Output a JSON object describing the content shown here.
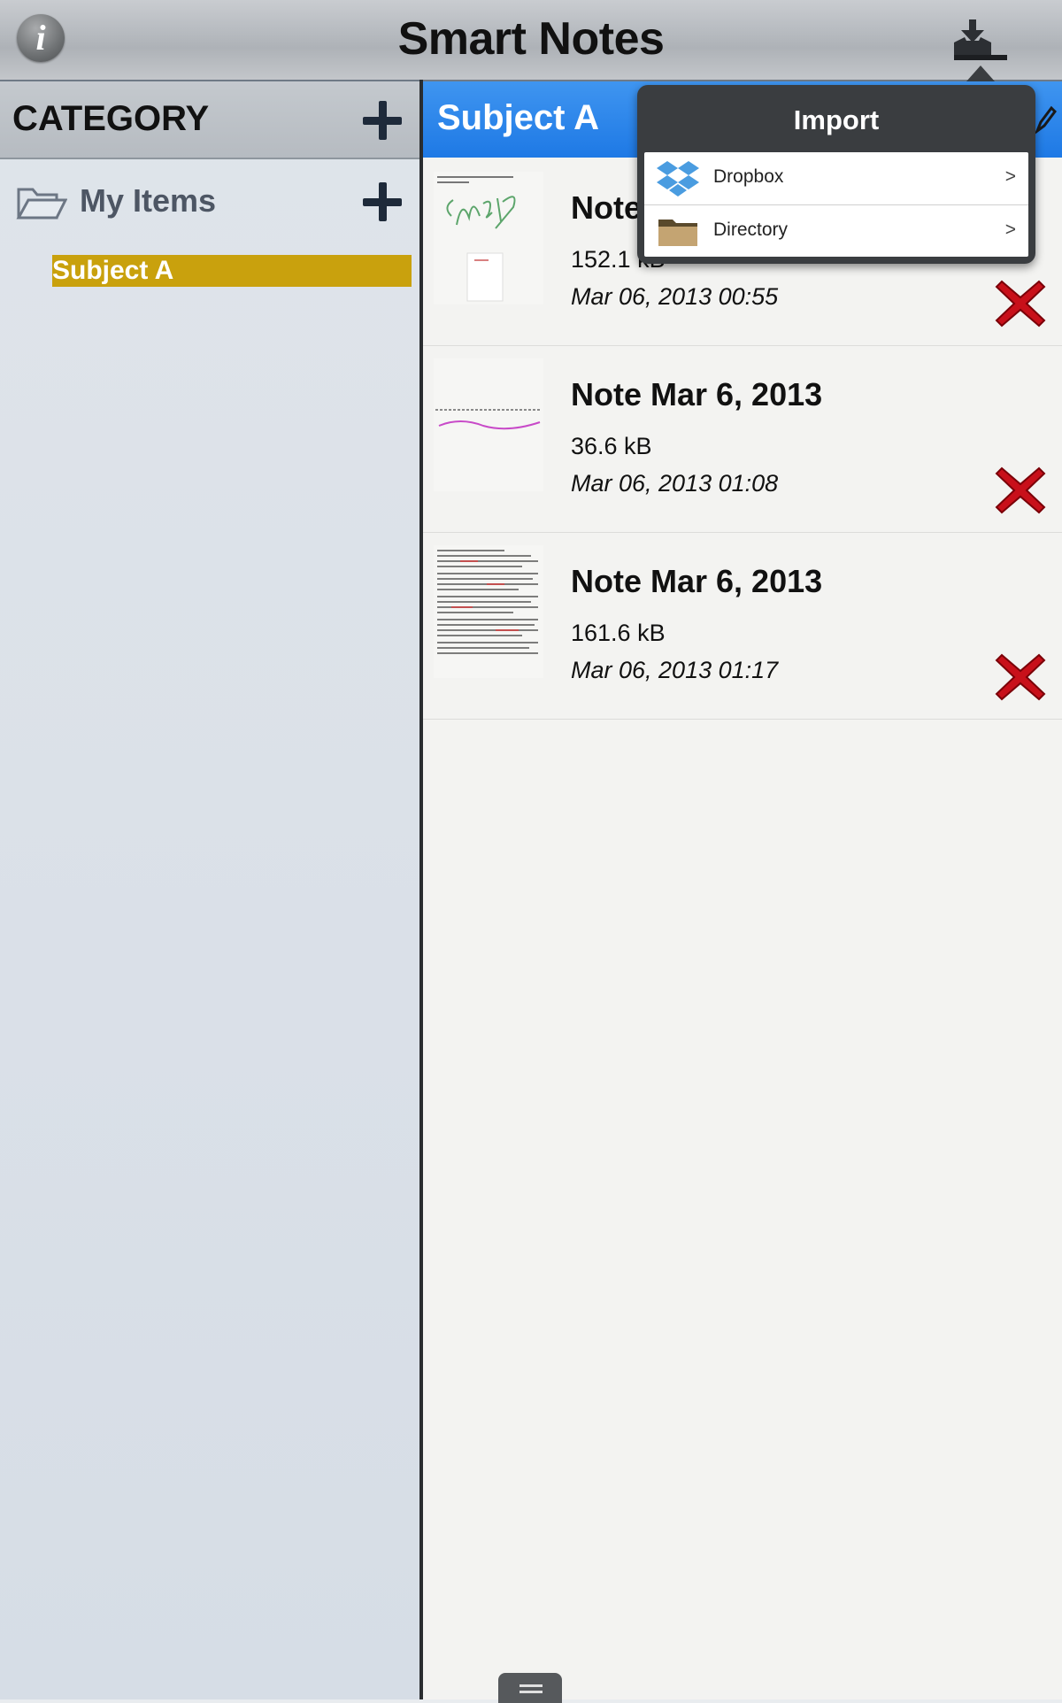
{
  "app": {
    "title": "Smart Notes"
  },
  "toolbar": {
    "info_label": "i"
  },
  "sidebar": {
    "header": "CATEGORY",
    "group": {
      "label": "My Items"
    },
    "items": [
      {
        "label": "Subject A",
        "selected": true
      }
    ]
  },
  "main": {
    "header": "Subject A",
    "notes": [
      {
        "title": "Note",
        "size": "152.1 kB",
        "date": "Mar 06, 2013 00:55"
      },
      {
        "title": "Note Mar 6, 2013",
        "size": "36.6 kB",
        "date": "Mar 06, 2013 01:08"
      },
      {
        "title": "Note Mar 6, 2013",
        "size": "161.6 kB",
        "date": "Mar 06, 2013 01:17"
      }
    ]
  },
  "import_popover": {
    "title": "Import",
    "options": [
      {
        "label": "Dropbox",
        "chevron": ">",
        "icon": "dropbox-icon"
      },
      {
        "label": "Directory",
        "chevron": ">",
        "icon": "folder-icon"
      }
    ]
  },
  "colors": {
    "accent_blue": "#1e79e5",
    "selected_item": "#c9a10d",
    "delete_red": "#c8101a"
  }
}
